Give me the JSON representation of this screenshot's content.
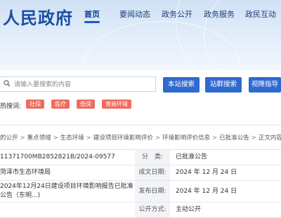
{
  "header": {
    "logo_text": "人民政府",
    "nav": [
      {
        "label": "首页",
        "active": true
      },
      {
        "label": "要闻动态",
        "active": false
      },
      {
        "label": "政务公开",
        "active": false
      },
      {
        "label": "政务服务",
        "active": false
      },
      {
        "label": "政民互动",
        "active": false
      }
    ]
  },
  "search": {
    "placeholder": "请输入要搜索的内容",
    "site_button": "本站搜索",
    "group_button": "站群搜索",
    "accessibility_button": "视障指导"
  },
  "hot": {
    "label": "热搜词:",
    "tags": [
      "社保",
      "医疗",
      "低保",
      "营商环境"
    ]
  },
  "breadcrumb": [
    "的公开",
    "重点领域",
    "生态环境",
    "建设项目环境影响评价",
    "环境影响评价信息",
    "已批准公告",
    "正文内容"
  ],
  "info": {
    "index_no": "11371700MB2852821B/2024-09577",
    "publisher": "菏泽市生态环境局",
    "title": "2024年12月24日建设项目环境影响报告已批准公告（东明...)",
    "rows": [
      {
        "label": "分　类:",
        "value": "已批准公告"
      },
      {
        "label": "成文日期:",
        "value": "2024 年 12 月 24 日"
      },
      {
        "label": "发布日期:",
        "value": "2024 年 12 月 24 日"
      },
      {
        "label": "公开方式:",
        "value": "主动公开"
      }
    ]
  },
  "colors": {
    "primary": "#2f6ad0",
    "hot_tag": "#ef6b5d",
    "logo": "#1b4fa6"
  }
}
